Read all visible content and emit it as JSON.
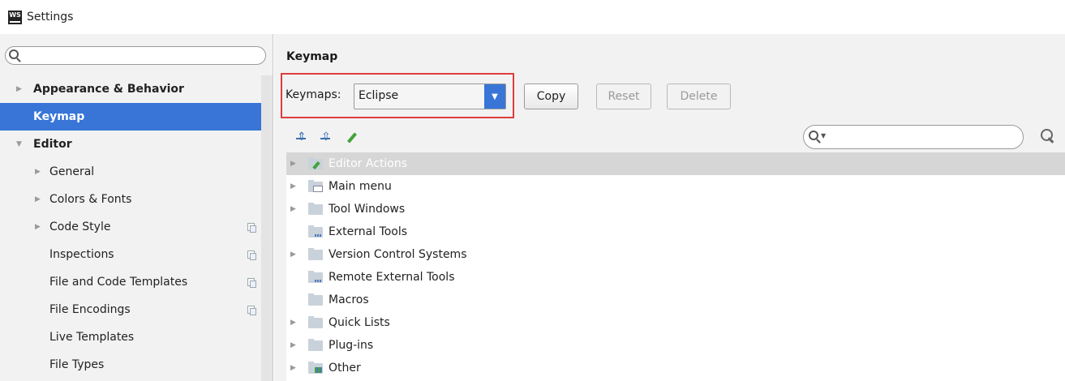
{
  "window": {
    "app_icon": "WS",
    "title": "Settings"
  },
  "sidebar": {
    "search": {
      "value": "",
      "placeholder": ""
    },
    "items": [
      {
        "label": "Appearance & Behavior",
        "level": 0,
        "expandable": true,
        "expanded": false,
        "bold": true,
        "selected": false,
        "project_icon": false
      },
      {
        "label": "Keymap",
        "level": 0,
        "expandable": false,
        "expanded": false,
        "bold": true,
        "selected": true,
        "project_icon": false
      },
      {
        "label": "Editor",
        "level": 0,
        "expandable": true,
        "expanded": true,
        "bold": true,
        "selected": false,
        "project_icon": false
      },
      {
        "label": "General",
        "level": 1,
        "expandable": true,
        "expanded": false,
        "bold": false,
        "selected": false,
        "project_icon": false
      },
      {
        "label": "Colors & Fonts",
        "level": 1,
        "expandable": true,
        "expanded": false,
        "bold": false,
        "selected": false,
        "project_icon": false
      },
      {
        "label": "Code Style",
        "level": 1,
        "expandable": true,
        "expanded": false,
        "bold": false,
        "selected": false,
        "project_icon": true
      },
      {
        "label": "Inspections",
        "level": 1,
        "expandable": false,
        "expanded": false,
        "bold": false,
        "selected": false,
        "project_icon": true
      },
      {
        "label": "File and Code Templates",
        "level": 1,
        "expandable": false,
        "expanded": false,
        "bold": false,
        "selected": false,
        "project_icon": true
      },
      {
        "label": "File Encodings",
        "level": 1,
        "expandable": false,
        "expanded": false,
        "bold": false,
        "selected": false,
        "project_icon": true
      },
      {
        "label": "Live Templates",
        "level": 1,
        "expandable": false,
        "expanded": false,
        "bold": false,
        "selected": false,
        "project_icon": false
      },
      {
        "label": "File Types",
        "level": 1,
        "expandable": false,
        "expanded": false,
        "bold": false,
        "selected": false,
        "project_icon": false
      }
    ]
  },
  "main": {
    "section_title": "Keymap",
    "keymaps_label": "Keymaps:",
    "keymap_selected": "Eclipse",
    "buttons": {
      "copy": "Copy",
      "reset": "Reset",
      "delete": "Delete"
    },
    "filter": {
      "value": "",
      "placeholder": ""
    },
    "actions": [
      {
        "label": "Editor Actions",
        "expandable": true,
        "icon": "editor-actions-folder-icon",
        "highlighted": true
      },
      {
        "label": "Main menu",
        "expandable": true,
        "icon": "main-menu-folder-icon",
        "highlighted": false
      },
      {
        "label": "Tool Windows",
        "expandable": true,
        "icon": "folder-icon",
        "highlighted": false
      },
      {
        "label": "External Tools",
        "expandable": false,
        "icon": "external-tools-folder-icon",
        "highlighted": false
      },
      {
        "label": "Version Control Systems",
        "expandable": true,
        "icon": "folder-icon",
        "highlighted": false
      },
      {
        "label": "Remote External Tools",
        "expandable": false,
        "icon": "external-tools-folder-icon",
        "highlighted": false
      },
      {
        "label": "Macros",
        "expandable": false,
        "icon": "folder-icon",
        "highlighted": false
      },
      {
        "label": "Quick Lists",
        "expandable": true,
        "icon": "folder-icon",
        "highlighted": false
      },
      {
        "label": "Plug-ins",
        "expandable": true,
        "icon": "folder-icon",
        "highlighted": false
      },
      {
        "label": "Other",
        "expandable": true,
        "icon": "other-folder-icon",
        "highlighted": false
      }
    ]
  },
  "colors": {
    "selection": "#3875d7",
    "highlight_border": "#e03c3c",
    "panel_bg": "#f2f2f2"
  }
}
